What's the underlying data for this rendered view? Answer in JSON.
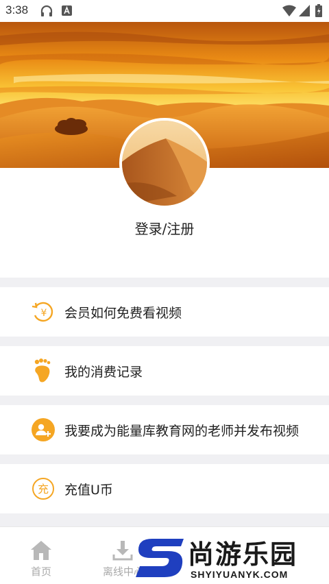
{
  "status_bar": {
    "time": "3:38",
    "icons": [
      "headphones-icon",
      "a-badge-icon",
      "wifi-icon",
      "signal-icon",
      "battery-icon"
    ]
  },
  "profile": {
    "login_label": "登录/注册",
    "banner_image": "desert-sunset",
    "avatar_image": "sand-dune"
  },
  "menu": {
    "items": [
      {
        "label": "会员如何免费看视频",
        "icon": "yen-refresh-icon"
      },
      {
        "label": "我的消费记录",
        "icon": "footprint-icon"
      },
      {
        "label": "我要成为能量库教育网的老师并发布视频",
        "icon": "add-user-icon"
      },
      {
        "label": "充值U币",
        "icon": "recharge-icon"
      }
    ]
  },
  "bottom_nav": {
    "items": [
      {
        "label": "首页",
        "icon": "home-icon"
      },
      {
        "label": "离线中心",
        "icon": "download-icon"
      }
    ]
  },
  "watermark": {
    "title": "尚游乐园",
    "subtitle": "SHYIYUANYK.COM"
  },
  "colors": {
    "accent": "#f5a623",
    "separator": "#f0f0f3",
    "nav_inactive": "#a9a9a9"
  }
}
